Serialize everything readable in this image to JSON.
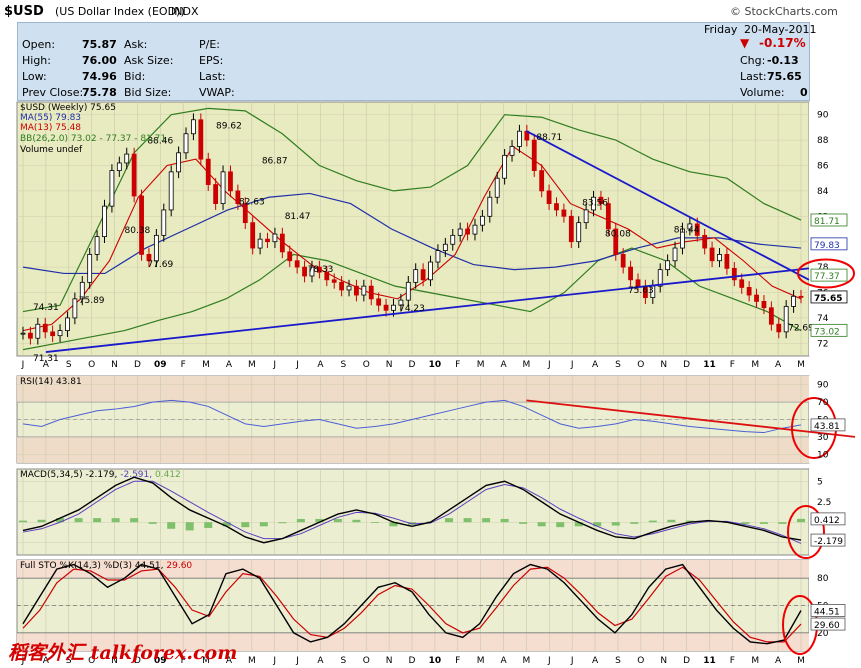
{
  "header": {
    "symbol": "$USD",
    "name": "(US Dollar Index (EOD))",
    "exchange": "INDX",
    "brand": "© StockCharts.com"
  },
  "quote": {
    "open_label": "Open:",
    "open": "75.87",
    "high_label": "High:",
    "high": "76.00",
    "low_label": "Low:",
    "low": "74.96",
    "prev_label": "Prev Close:",
    "prev": "75.78",
    "ask_label": "Ask:",
    "asksize_label": "Ask Size:",
    "bid_label": "Bid:",
    "bidsize_label": "Bid Size:",
    "pe_label": "P/E:",
    "eps_label": "EPS:",
    "last_label": "Last:",
    "vwap_label": "VWAP:",
    "day": "Friday",
    "date": "20-May-2011",
    "change_pct": "-0.17%",
    "chg_label": "Chg:",
    "chg": "-0.13",
    "last2_label": "Last:",
    "last": "75.65",
    "volume_label": "Volume:",
    "volume": "0"
  },
  "legend": {
    "price": "$USD (Weekly) 75.65",
    "ma55": "MA(55) 79.83",
    "ma13": "MA(13) 75.48",
    "bb": "BB(26,2.0) 73.02 - 77.37 - 81.71",
    "volume": "Volume undef",
    "rsi": "RSI(14) 43.81",
    "macd_a": "MACD(5,34,5) -2.179,",
    "macd_b": "-2.591,",
    "macd_c": "0.412",
    "sto_a": "Full STO %K(14,3) %D(3) 44.51,",
    "sto_b": "29.60"
  },
  "watermark": "稻客外汇 talkforex.com",
  "colors": {
    "bg": "#e8eac0",
    "up": "#000000",
    "down": "#cc0000",
    "ma55": "#1f2fa8",
    "ma13": "#cc0000",
    "bb": "#2e7d1f",
    "trend": "#1a1acc",
    "rsi": "#4a5fd6",
    "macd": "#000000",
    "signal": "#5b3fbf",
    "hist": "#7fc06a",
    "stoK": "#000000",
    "stoD": "#cc0000"
  },
  "chart_data": [
    {
      "type": "line",
      "title": "$USD (Weekly) 75.65",
      "x_labels": [
        "J",
        "A",
        "S",
        "O",
        "N",
        "D",
        "09",
        "F",
        "M",
        "A",
        "M",
        "J",
        "J",
        "A",
        "S",
        "O",
        "N",
        "D",
        "10",
        "F",
        "M",
        "A",
        "M",
        "J",
        "J",
        "A",
        "S",
        "O",
        "N",
        "D",
        "11",
        "F",
        "M",
        "A",
        "M"
      ],
      "y_ticks": [
        72,
        74,
        76,
        78,
        80,
        82,
        84,
        86,
        88,
        90
      ],
      "ylim": [
        71,
        91
      ],
      "series": [
        {
          "name": "$USD (Weekly)",
          "values": [
            72.8,
            72.4,
            73.5,
            72.9,
            72.6,
            73.0,
            74.0,
            75.5,
            76.8,
            79.0,
            80.4,
            82.8,
            85.6,
            86.2,
            86.9,
            83.6,
            79.0,
            78.5,
            80.5,
            82.5,
            85.5,
            87.0,
            88.5,
            89.6,
            86.5,
            84.5,
            83.0,
            85.5,
            84.0,
            83.0,
            81.5,
            79.5,
            80.2,
            80.0,
            80.6,
            79.2,
            78.5,
            78.0,
            77.3,
            78.0,
            77.6,
            77.0,
            76.8,
            76.2,
            76.5,
            75.8,
            76.5,
            75.5,
            75.0,
            74.6,
            75.0,
            75.4,
            76.8,
            77.8,
            77.0,
            78.4,
            79.3,
            79.8,
            80.5,
            81.0,
            80.6,
            81.3,
            82.0,
            83.5,
            85.0,
            86.8,
            87.5,
            88.7,
            88.0,
            85.6,
            84.0,
            83.0,
            82.5,
            82.0,
            80.0,
            81.5,
            82.5,
            83.5,
            83.0,
            81.0,
            79.0,
            78.0,
            77.0,
            76.5,
            75.6,
            76.5,
            77.8,
            78.5,
            79.5,
            81.0,
            81.4,
            80.5,
            79.5,
            78.5,
            79.0,
            77.9,
            77.0,
            76.4,
            75.8,
            75.3,
            74.8,
            73.5,
            72.9,
            74.9,
            75.7,
            75.65
          ]
        },
        {
          "name": "MA(55)",
          "values": [
            78,
            77.5,
            77.5,
            79.5,
            81,
            82.5,
            83.5,
            83.8,
            83,
            81,
            79.5,
            78.2,
            77.8,
            78,
            78.5,
            79.5,
            80.3,
            80.3,
            79.8,
            79.5
          ]
        },
        {
          "name": "MA(13)",
          "values": [
            73,
            73.5,
            75.5,
            78.5,
            83.5,
            86,
            86.5,
            84,
            82,
            80,
            78.2,
            77,
            76,
            75.5,
            77,
            79,
            83.5,
            87.5,
            86,
            83,
            82,
            81,
            79.5,
            80,
            80.3,
            78.5,
            76.5,
            75.5
          ]
        },
        {
          "name": "BB upper",
          "values": [
            74.5,
            75,
            81,
            87,
            90,
            90.5,
            90.3,
            88.5,
            86,
            84.8,
            84,
            84.3,
            86,
            90,
            89.8,
            88.8,
            88,
            86.5,
            85.5,
            85,
            83,
            81.7
          ]
        },
        {
          "name": "BB lower",
          "values": [
            71.5,
            72,
            72.5,
            73,
            73.8,
            74.5,
            75.5,
            77,
            79,
            78.5,
            77.5,
            76.5,
            76,
            75.5,
            75,
            74.5,
            76,
            78.5,
            79.5,
            78.5,
            76.5,
            75.5,
            74.5,
            73
          ]
        }
      ],
      "trendlines": [
        {
          "from": [
            71.31,
            "J"
          ],
          "to": [
            77.5,
            "M"
          ]
        },
        {
          "from": [
            88.71,
            "J"
          ],
          "to": [
            77.5,
            "M"
          ]
        }
      ],
      "annotations": [
        "71.31",
        "74.31",
        "75.89",
        "80.38",
        "88.46",
        "77.69",
        "89.62",
        "82.63",
        "86.87",
        "81.47",
        "78.33",
        "74.23",
        "88.71",
        "80.08",
        "83.56",
        "75.63",
        "81.44",
        "72.69"
      ],
      "right_labels": [
        "81.71",
        "79.83",
        "77.37",
        "75.65",
        "73.02"
      ],
      "legend": "top-left"
    },
    {
      "type": "line",
      "title": "RSI(14) 43.81",
      "y_ticks": [
        10,
        30,
        50,
        70,
        90
      ],
      "ylim": [
        0,
        100
      ],
      "series": [
        {
          "name": "RSI(14)",
          "values": [
            45,
            42,
            50,
            55,
            60,
            62,
            65,
            70,
            72,
            70,
            65,
            55,
            45,
            42,
            45,
            48,
            50,
            45,
            40,
            42,
            45,
            50,
            55,
            60,
            65,
            70,
            72,
            65,
            55,
            45,
            40,
            42,
            45,
            50,
            48,
            45,
            42,
            40,
            38,
            36,
            35,
            40,
            43.81
          ]
        }
      ],
      "right_labels": [
        "43.81"
      ]
    },
    {
      "type": "line",
      "title": "MACD(5,34,5) -2.179, -2.591, 0.412",
      "y_ticks": [
        -2.5,
        0,
        2.5,
        5
      ],
      "ylim": [
        -4,
        6.5
      ],
      "series": [
        {
          "name": "MACD",
          "values": [
            -1,
            -0.5,
            0.5,
            1.5,
            3,
            4.5,
            5.5,
            4.8,
            3,
            1.5,
            0.5,
            -0.5,
            -1.8,
            -2.5,
            -2,
            -1,
            0,
            1,
            1.5,
            1,
            0,
            -0.5,
            0,
            1.5,
            3,
            4.5,
            5,
            4,
            2.5,
            1,
            0,
            -1,
            -1.8,
            -2,
            -1.2,
            -0.5,
            0,
            0.2,
            0,
            -0.5,
            -1,
            -1.8,
            -2.179
          ]
        },
        {
          "name": "Signal",
          "values": [
            -1.2,
            -0.8,
            0,
            1,
            2.5,
            4,
            5,
            5,
            3.8,
            2.5,
            1.2,
            0,
            -1.2,
            -2,
            -2,
            -1.4,
            -0.4,
            0.6,
            1.2,
            1.1,
            0.5,
            -0.2,
            -0.1,
            1,
            2.5,
            4,
            4.6,
            4.2,
            3,
            1.6,
            0.5,
            -0.5,
            -1.4,
            -1.8,
            -1.4,
            -0.8,
            -0.2,
            0.1,
            0.1,
            -0.3,
            -0.8,
            -1.6,
            -2.591
          ]
        }
      ],
      "histogram": [
        0.2,
        0.3,
        0.5,
        0.5,
        0.5,
        0.5,
        0.5,
        -0.2,
        -0.8,
        -1,
        -0.7,
        -0.5,
        -0.6,
        -0.5,
        0,
        0.4,
        0.4,
        0.4,
        0.3,
        -0.1,
        -0.5,
        -0.3,
        0.1,
        0.5,
        0.5,
        0.5,
        0.4,
        -0.2,
        -0.5,
        -0.6,
        -0.5,
        -0.5,
        -0.4,
        -0.2,
        0.2,
        0.3,
        0.2,
        0.1,
        -0.1,
        -0.2,
        -0.2,
        -0.2,
        0.412
      ],
      "right_labels": [
        "0.412",
        "-2.179"
      ]
    },
    {
      "type": "line",
      "title": "Full STO %K(14,3) %D(3) 44.51, 29.60",
      "y_ticks": [
        20,
        50,
        80
      ],
      "ylim": [
        0,
        100
      ],
      "series": [
        {
          "name": "%K",
          "values": [
            30,
            60,
            90,
            95,
            85,
            70,
            80,
            95,
            90,
            60,
            30,
            40,
            85,
            90,
            80,
            50,
            20,
            10,
            15,
            30,
            50,
            70,
            75,
            65,
            40,
            20,
            15,
            30,
            60,
            85,
            95,
            90,
            75,
            55,
            35,
            20,
            40,
            70,
            90,
            95,
            70,
            45,
            25,
            10,
            8,
            12,
            44.51
          ]
        },
        {
          "name": "%D",
          "values": [
            25,
            45,
            75,
            90,
            88,
            78,
            78,
            88,
            90,
            70,
            45,
            38,
            65,
            85,
            82,
            60,
            35,
            18,
            15,
            25,
            42,
            62,
            72,
            68,
            50,
            30,
            20,
            25,
            48,
            72,
            90,
            92,
            80,
            62,
            42,
            28,
            35,
            58,
            82,
            92,
            78,
            55,
            32,
            15,
            10,
            10,
            29.6
          ]
        }
      ],
      "right_labels": [
        "44.51",
        "29.60"
      ]
    }
  ]
}
